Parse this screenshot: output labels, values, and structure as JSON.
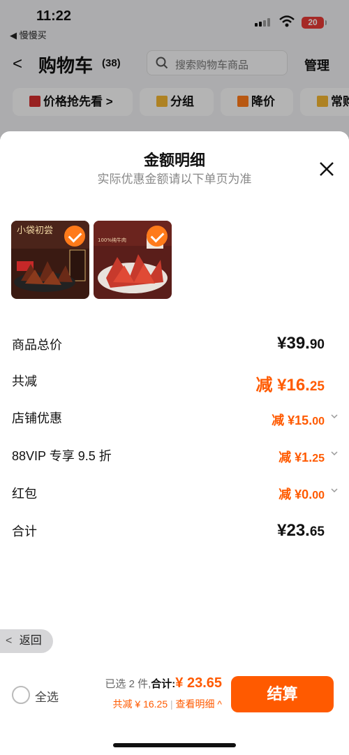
{
  "status": {
    "time": "11:22",
    "back_app": "◀ 慢慢买",
    "battery": "20"
  },
  "header": {
    "back": "<",
    "title": "购物车",
    "count": "(38)",
    "search_placeholder": "搜索购物车商品",
    "manage": "管理"
  },
  "chips": [
    {
      "label": "价格抢先看 >",
      "icon_color": "#d32f2f"
    },
    {
      "label": "分组",
      "icon_color": "#f2b431"
    },
    {
      "label": "降价",
      "icon_color": "#ff7a1a"
    },
    {
      "label": "常购",
      "icon_color": "#f2b431"
    }
  ],
  "sheet": {
    "title": "金额明细",
    "subtitle": "实际优惠金额请以下单页为准",
    "products": [
      {
        "label": "小袋初尝",
        "name": "product-thumb-1"
      },
      {
        "label": "100%纯牛肉",
        "name": "product-thumb-2"
      }
    ],
    "rows": {
      "total": {
        "label": "商品总价",
        "yuan": "¥39.",
        "dec": "90"
      },
      "reduce": {
        "label": "共减",
        "yuan": "减 ¥16.",
        "dec": "25"
      },
      "shop": {
        "label": "店铺优惠",
        "yuan": "减 ¥15.",
        "dec": "00"
      },
      "vip": {
        "label": "88VIP 专享 9.5 折",
        "yuan": "减 ¥1.",
        "dec": "25"
      },
      "redpack": {
        "label": "红包",
        "yuan": "减 ¥0.",
        "dec": "00"
      },
      "sum": {
        "label": "合计",
        "yuan": "¥23.",
        "dec": "65"
      }
    }
  },
  "return_label": "返回",
  "bottom": {
    "select_all": "全选",
    "selected": "已选 2 件,",
    "total_label": "合计:",
    "total_value": "¥ 23.65",
    "reduce_text": "共减 ¥ 16.25",
    "divider": "|",
    "detail": "查看明细",
    "detail_arrow": "^",
    "pay": "结算"
  },
  "colors": {
    "accent": "#ff5a00",
    "check": "#ff7a1a"
  }
}
